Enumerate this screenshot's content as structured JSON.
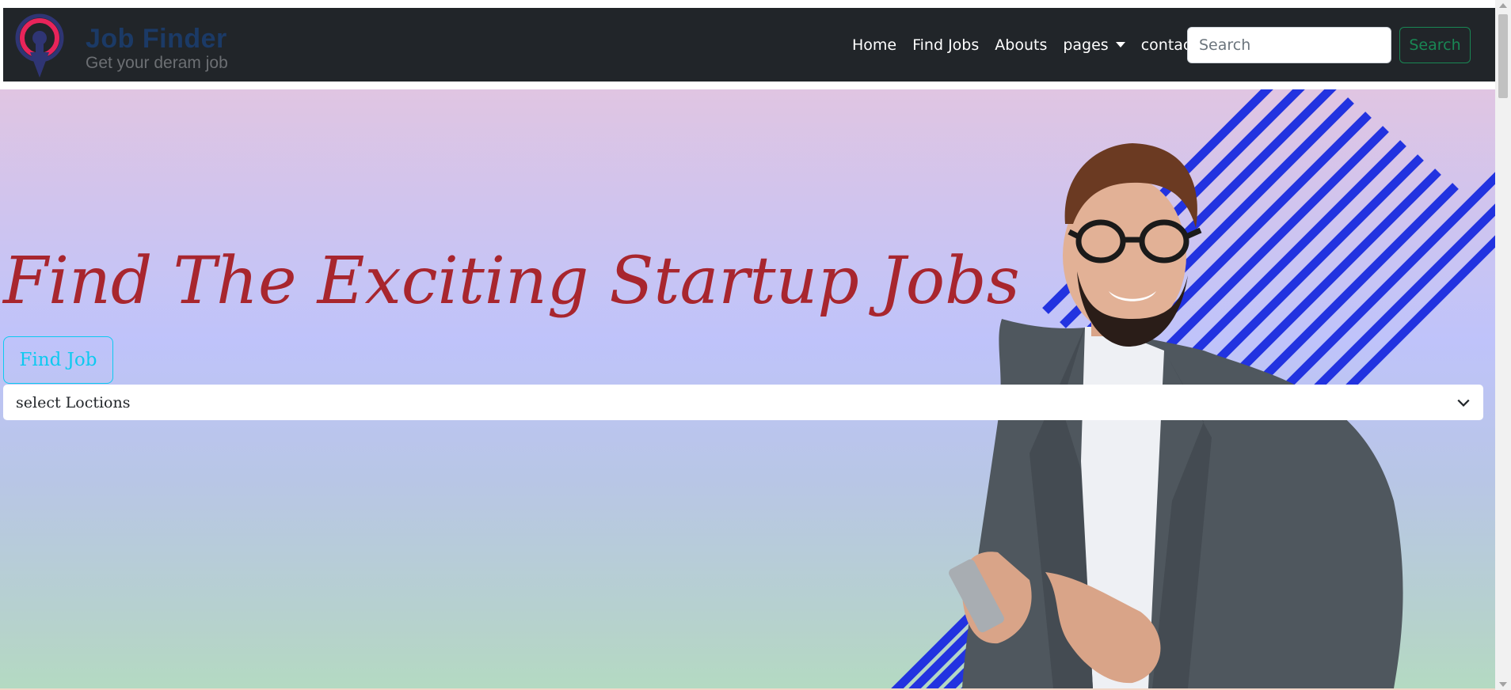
{
  "brand": {
    "title": "Job Finder",
    "subtitle": "Get your deram job",
    "logo_icon": "location-pin-icon",
    "colors": {
      "logo_ring": "#e8245a",
      "logo_body": "#2f3574",
      "title": "#1b3a66"
    }
  },
  "nav": {
    "items": [
      {
        "label": "Home"
      },
      {
        "label": "Find Jobs"
      },
      {
        "label": "Abouts"
      },
      {
        "label": "pages",
        "dropdown": true
      },
      {
        "label": "contact"
      }
    ],
    "search_placeholder": "Search",
    "search_button": "Search",
    "colors": {
      "bar": "#212529",
      "search_button": "#198754"
    }
  },
  "hero": {
    "title": "Find The Exciting Startup Jobs",
    "find_button": "Find Job",
    "location_select": {
      "selected": "select Loctions"
    },
    "colors": {
      "title": "#a8262e",
      "find_button": "#0dcaf0",
      "stripes": "#2233e0"
    },
    "image": "smiling-man-holding-phone"
  }
}
